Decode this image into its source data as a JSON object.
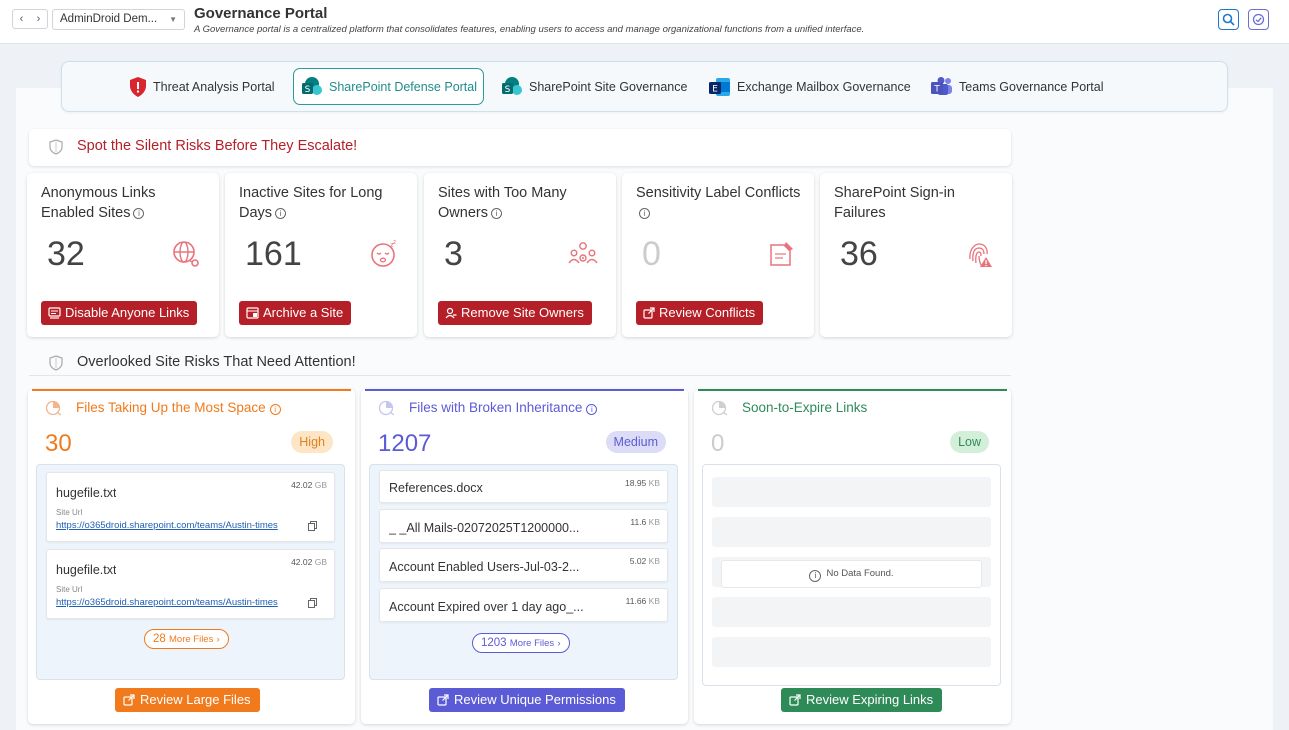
{
  "header": {
    "tenant": "AdminDroid Dem...",
    "title": "Governance Portal",
    "subtitle": "A Governance portal is a centralized platform that consolidates features, enabling users to access and manage organizational functions from a unified interface."
  },
  "tabs": [
    {
      "label": "Threat Analysis Portal",
      "active": false
    },
    {
      "label": "SharePoint Defense Portal",
      "active": true
    },
    {
      "label": "SharePoint Site Governance",
      "active": false
    },
    {
      "label": "Exchange Mailbox Governance",
      "active": false
    },
    {
      "label": "Teams Governance Portal",
      "active": false
    }
  ],
  "sections": {
    "silent": "Spot the Silent Risks Before They Escalate!",
    "overlooked": "Overlooked Site Risks That Need Attention!"
  },
  "kpis": [
    {
      "title": "Anonymous Links Enabled Sites",
      "value": "32",
      "button": "Disable Anyone Links",
      "icon": "globe-link-icon"
    },
    {
      "title": "Inactive Sites for Long Days",
      "value": "161",
      "button": "Archive a Site",
      "icon": "sleepy-face-icon"
    },
    {
      "title": "Sites with Too Many Owners",
      "value": "3",
      "button": "Remove Site Owners",
      "icon": "users-gear-icon"
    },
    {
      "title": "Sensitivity Label Conflicts",
      "value": "0",
      "button": "Review Conflicts",
      "icon": "label-conflict-icon"
    },
    {
      "title": "SharePoint Sign-in Failures",
      "value": "36",
      "button": "",
      "icon": "fingerprint-warning-icon"
    }
  ],
  "risks": {
    "large": {
      "title": "Files Taking Up the Most Space",
      "value": "30",
      "severity": "High",
      "files": [
        {
          "name": "hugefile.txt",
          "size": "42.02",
          "unit": "GB",
          "url_label": "Site Url",
          "url": "https://o365droid.sharepoint.com/teams/Austin-times"
        },
        {
          "name": "hugefile.txt",
          "size": "42.02",
          "unit": "GB",
          "url_label": "Site Url",
          "url": "https://o365droid.sharepoint.com/teams/Austin-times"
        }
      ],
      "more_count": "28",
      "more_label": "More Files",
      "button": "Review Large Files",
      "color": "#f07a1c"
    },
    "broken": {
      "title": "Files with Broken Inheritance",
      "value": "1207",
      "severity": "Medium",
      "files": [
        {
          "name": "References.docx",
          "size": "18.95",
          "unit": "KB"
        },
        {
          "name": "_ _All Mails-02072025T1200000...",
          "size": "11.6",
          "unit": "KB"
        },
        {
          "name": "Account Enabled Users-Jul-03-2...",
          "size": "5.02",
          "unit": "KB"
        },
        {
          "name": "Account Expired over 1 day ago_...",
          "size": "11.66",
          "unit": "KB"
        }
      ],
      "more_count": "1203",
      "more_label": "More Files",
      "button": "Review Unique Permissions",
      "color": "#5b5bd6"
    },
    "expire": {
      "title": "Soon-to-Expire Links",
      "value": "0",
      "severity": "Low",
      "empty_message": "No Data Found.",
      "button": "Review Expiring Links",
      "color": "#2e8b57"
    }
  },
  "colors": {
    "danger": "#b51f27",
    "teal": "#2b9a9a",
    "orange": "#f07a1c",
    "indigo": "#5b5bd6",
    "green": "#2e8b57"
  }
}
